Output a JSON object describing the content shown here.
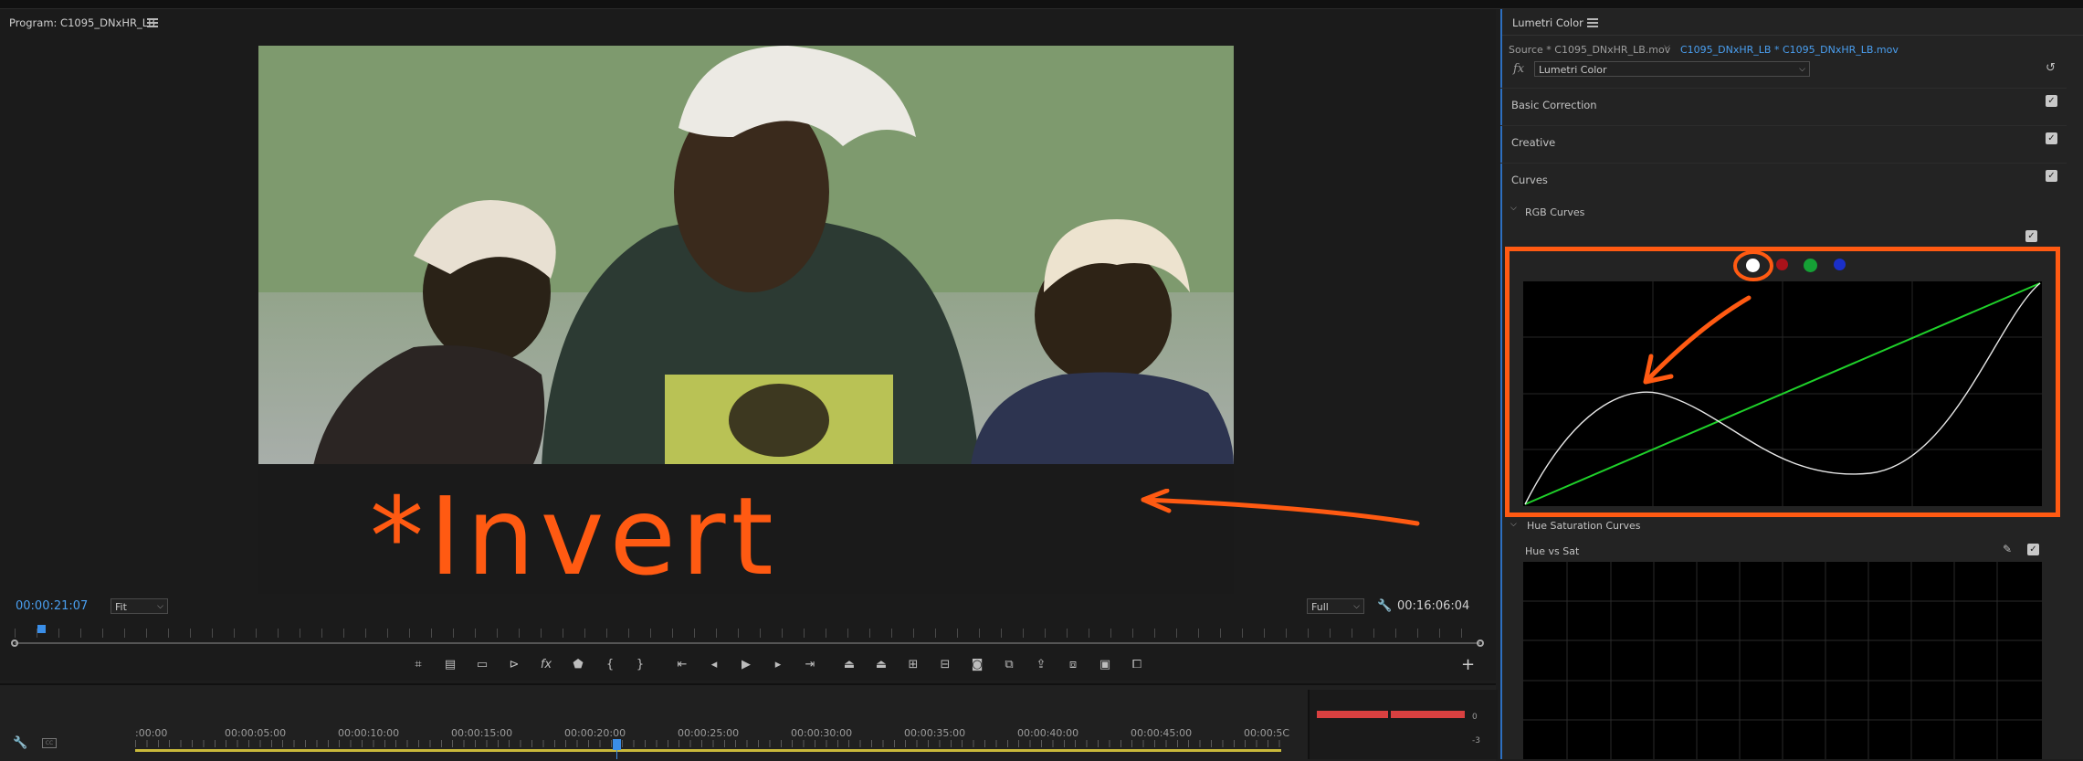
{
  "program": {
    "title": "Program: C1095_DNxHR_LB",
    "current_time": "00:00:21:07",
    "fit_select": "Fit",
    "quality_select": "Full",
    "duration": "00:16:06:04",
    "annotation_text": "*Invert"
  },
  "timeline": {
    "ruler_labels": [
      ":00:00",
      "00:00:05:00",
      "00:00:10:00",
      "00:00:15:00",
      "00:00:20:00",
      "00:00:25:00",
      "00:00:30:00",
      "00:00:35:00",
      "00:00:40:00",
      "00:00:45:00",
      "00:00:5C"
    ],
    "meter_labels": [
      "0",
      "-3"
    ]
  },
  "lumetri": {
    "title": "Lumetri Color",
    "source_label": "Source * C1095_DNxHR_LB.mov",
    "sequence_label": "C1095_DNxHR_LB * C1095_DNxHR_LB.mov",
    "fx_symbol": "fx",
    "effect_select": "Lumetri Color",
    "sections": [
      "Basic Correction",
      "Creative",
      "Curves"
    ],
    "rgb_curves": "RGB Curves",
    "hue_sat_curves": "Hue Saturation Curves",
    "hue_vs_sat": "Hue vs Sat",
    "channel_colors": [
      "#ffffff",
      "#c0161b",
      "#15a035",
      "#1a2fc8"
    ]
  },
  "colors": {
    "annotation": "#ff5a12",
    "accent_blue": "#4a9ff0",
    "curve_green": "#1fd12a"
  }
}
